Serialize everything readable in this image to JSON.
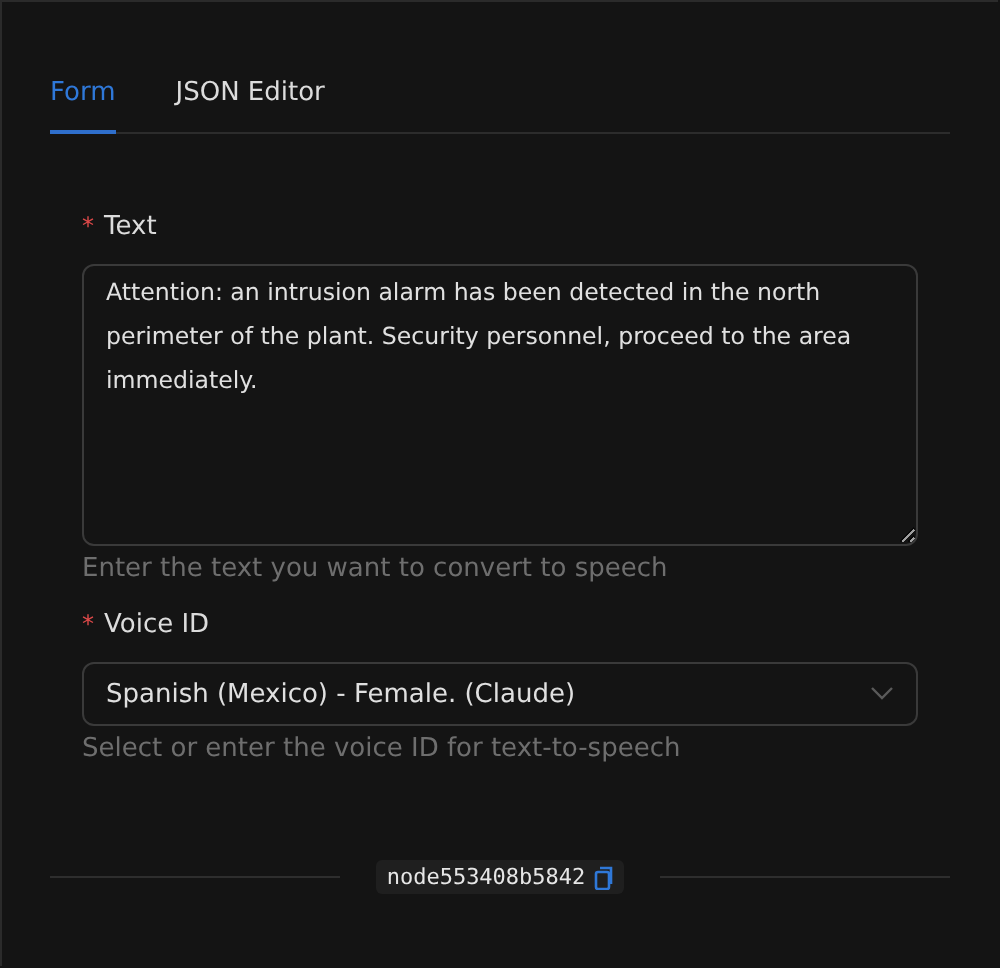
{
  "tabs": [
    {
      "label": "Form",
      "selected": true
    },
    {
      "label": "JSON Editor",
      "selected": false
    }
  ],
  "fields": [
    {
      "kind": "textarea",
      "label": "Text",
      "required": true,
      "required_mark": "*",
      "value": "Attention: an intrusion alarm has been detected in the north perimeter of the plant. Security personnel, proceed to the area immediately.",
      "help": "Enter the text you want to convert to speech"
    },
    {
      "kind": "select",
      "label": "Voice ID",
      "required": true,
      "required_mark": "*",
      "value": "Spanish (Mexico) - Female. (Claude)",
      "help": "Select or enter the voice ID for text-to-speech"
    }
  ],
  "node_id": "node553408b5842"
}
